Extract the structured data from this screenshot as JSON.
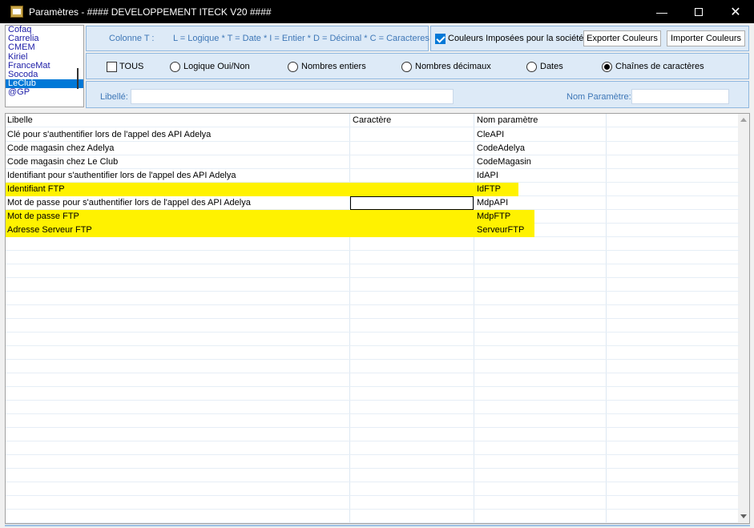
{
  "window": {
    "title": "Paramètres - #### DEVELOPPEMENT ITECK V20 ####",
    "minimize": "—",
    "close": "✕"
  },
  "companies": [
    {
      "label": "Cofaq",
      "selected": false
    },
    {
      "label": "Carrelia",
      "selected": false
    },
    {
      "label": "CMEM",
      "selected": false
    },
    {
      "label": "Kiriel",
      "selected": false
    },
    {
      "label": "FranceMat",
      "selected": false
    },
    {
      "label": "Socoda",
      "selected": false
    },
    {
      "label": "LeClub",
      "selected": true
    },
    {
      "label": "@GP",
      "selected": false
    }
  ],
  "legend": {
    "column_label": "Colonne T :",
    "text": "L = Logique * T = Date * I = Entier * D = Décimal * C = Caracteres"
  },
  "colors": {
    "imposed_label": "Couleurs Imposées pour la société",
    "imposed_checked": true,
    "export_label": "Exporter Couleurs",
    "import_label": "Importer Couleurs",
    "highlight": "#fff200",
    "accent": "#0078d7",
    "panel_bg": "#ddeaf7",
    "label_blue": "#3e77b7"
  },
  "filters": {
    "tous_label": "TOUS",
    "tous_checked": false,
    "options": [
      {
        "label": "Logique Oui/Non",
        "checked": false
      },
      {
        "label": "Nombres entiers",
        "checked": false
      },
      {
        "label": "Nombres décimaux",
        "checked": false
      },
      {
        "label": "Dates",
        "checked": false
      },
      {
        "label": "Chaînes de caractères",
        "checked": true
      }
    ]
  },
  "search": {
    "libelle_label": "Libellé:",
    "libelle_value": "",
    "nom_label": "Nom Paramètre:",
    "nom_value": ""
  },
  "table": {
    "headers": [
      "Libelle",
      "Caractère",
      "Nom paramètre"
    ],
    "rows": [
      {
        "libelle": "Clé pour s'authentifier lors de l'appel des API Adelya",
        "caractere": "",
        "nom": "CleAPI",
        "highlight": false
      },
      {
        "libelle": "Code magasin chez Adelya",
        "caractere": "",
        "nom": "CodeAdelya",
        "highlight": false
      },
      {
        "libelle": "Code magasin chez Le Club",
        "caractere": "",
        "nom": "CodeMagasin",
        "highlight": false
      },
      {
        "libelle": "Identifiant pour s'authentifier lors de l'appel des API Adelya",
        "caractere": "",
        "nom": "IdAPI",
        "highlight": false
      },
      {
        "libelle": "Identifiant FTP",
        "caractere": "",
        "nom": "IdFTP",
        "highlight": true
      },
      {
        "libelle": "Mot de passe pour s'authentifier lors de l'appel des API Adelya",
        "caractere": "",
        "nom": "MdpAPI",
        "highlight": false
      },
      {
        "libelle": "Mot de passe FTP",
        "caractere": "",
        "nom": "MdpFTP",
        "highlight": true
      },
      {
        "libelle": "Adresse Serveur FTP",
        "caractere": "",
        "nom": "ServeurFTP",
        "highlight": true
      }
    ]
  }
}
